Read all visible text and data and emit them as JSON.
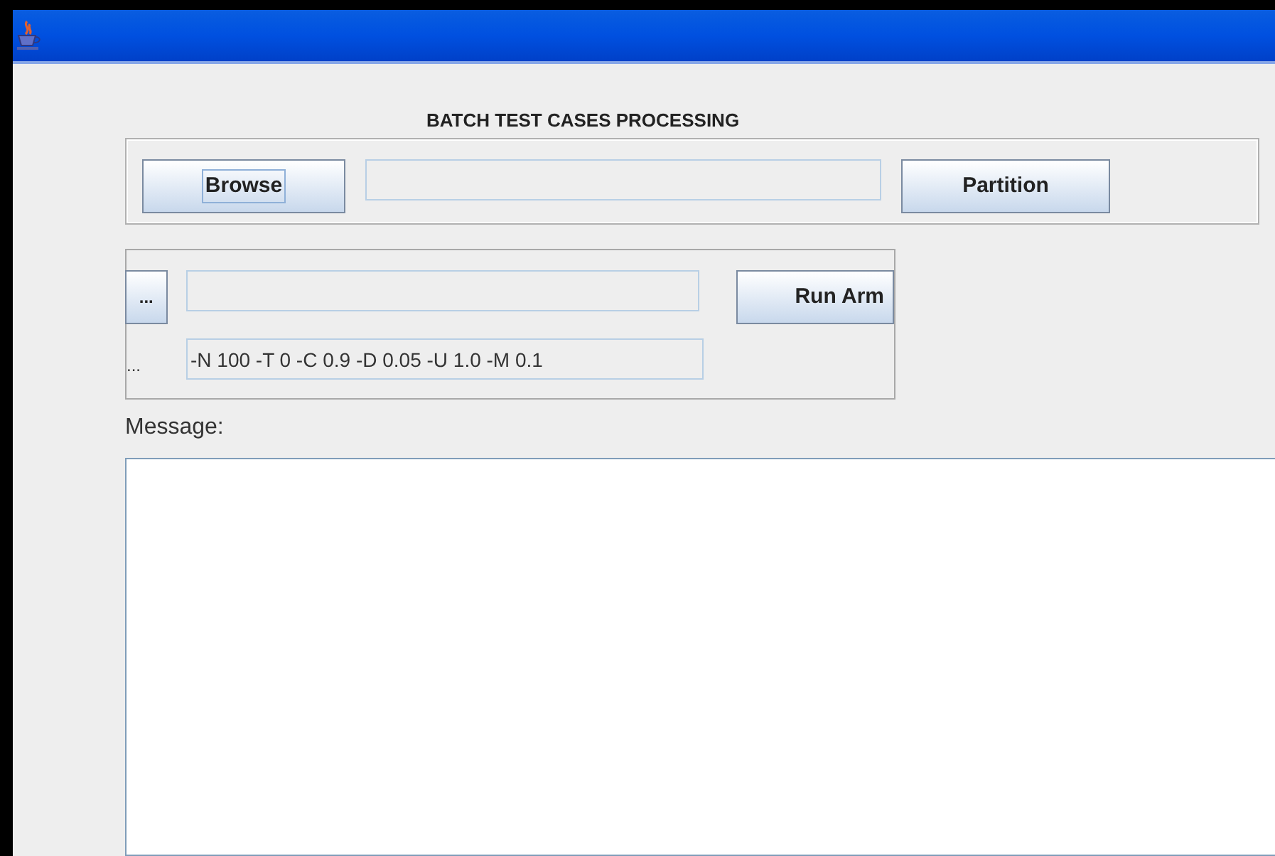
{
  "heading": "BATCH TEST CASES PROCESSING",
  "file_panel": {
    "browse_button": {
      "label": "Browse",
      "focused": true
    },
    "partition_button": {
      "label": "Partition",
      "focused": false
    }
  },
  "arm_panel": {
    "pick_button": {
      "label": "...",
      "focused": false
    },
    "run_button": {
      "label": "Run Arm",
      "focused": false
    },
    "options_label": "...",
    "options_field": {
      "value": "-N 100 -T 0 -C 0.9 -D 0.05 -U 1.0 -M 0.1"
    }
  },
  "message_label": "Message:"
}
